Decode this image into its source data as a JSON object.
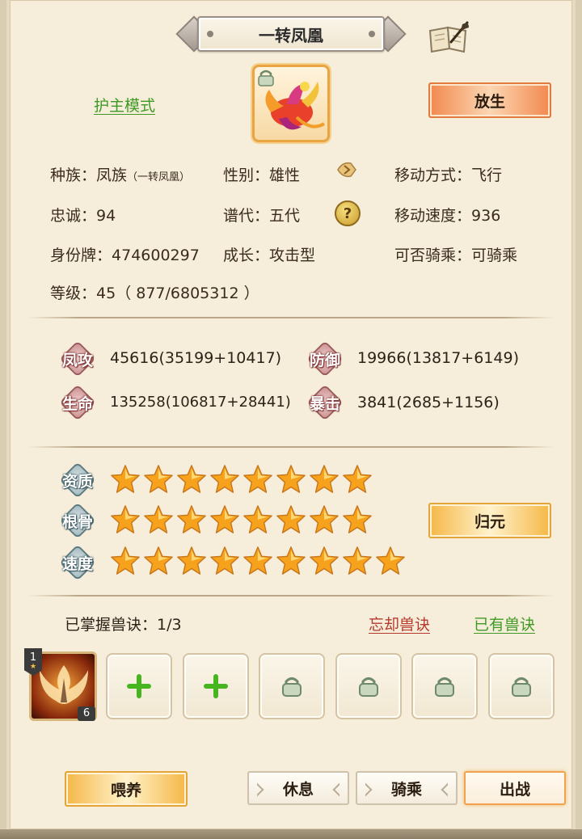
{
  "header": {
    "title": "一转凤凰",
    "book_icon": "scroll-quill-icon"
  },
  "top": {
    "guard_mode": "护主模式",
    "release_label": "放生",
    "portrait_icon": "phoenix-portrait",
    "lock_icon": "padlock-icon"
  },
  "info": {
    "race_label": "种族：",
    "race_value": "凤族",
    "race_sub": "（一转凤凰）",
    "gender_label": "性别：",
    "gender_value": "雄性",
    "move_label": "移动方式：",
    "move_value": "飞行",
    "loyalty_label": "忠诚：",
    "loyalty_value": "94",
    "gen_label": "谱代：",
    "gen_value": "五代",
    "help_label": "?",
    "speed_label": "移动速度：",
    "speed_value": "936",
    "id_label": "身份牌：",
    "id_value": "474600297",
    "growth_label": "成长：",
    "growth_value": "攻击型",
    "ride_label": "可否骑乘：",
    "ride_value": "可骑乘",
    "level_label": "等级：",
    "level_value": "45",
    "exp_value": "（ 877/6805312 ）"
  },
  "stats": {
    "attack_label": "凤攻",
    "attack_value": "45616(35199+10417)",
    "defense_label": "防御",
    "defense_value": "19966(13817+6149)",
    "hp_label": "生命",
    "hp_value": "135258(106817+28441)",
    "crit_label": "暴击",
    "crit_value": "3841(2685+1156)"
  },
  "quality": {
    "aptitude_label": "资质",
    "aptitude_stars": 8,
    "bone_label": "根骨",
    "bone_stars": 8,
    "speed_label": "速度",
    "speed_stars": 9,
    "return_label": "归元",
    "star_color": "#f6a21c"
  },
  "skills": {
    "mastered": "已掌握兽诀：1/3",
    "forget": "忘却兽诀",
    "owned": "已有兽诀",
    "first_tier": "1",
    "first_level": "6",
    "slots": [
      "skill",
      "plus",
      "plus",
      "lock",
      "lock",
      "lock",
      "lock"
    ]
  },
  "footer": {
    "feed": "喂养",
    "rest": "休息",
    "ride": "骑乘",
    "fight": "出战"
  }
}
